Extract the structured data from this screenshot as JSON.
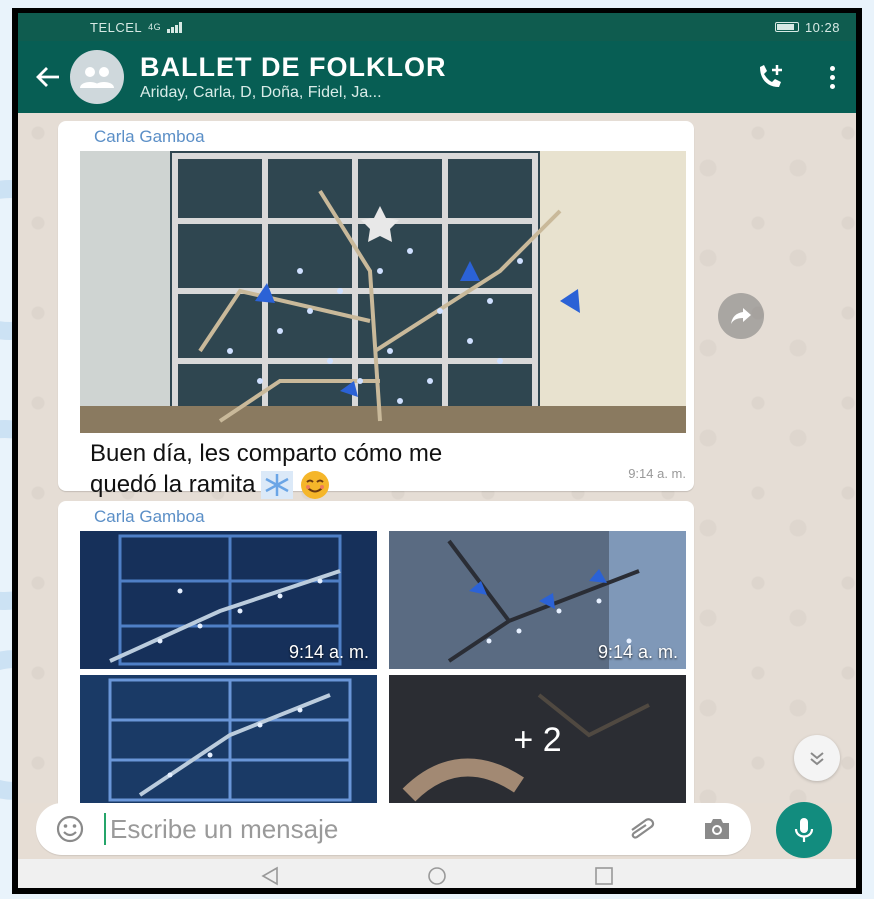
{
  "status_bar": {
    "carrier": "TELCEL",
    "network": "4G",
    "time": "10:28"
  },
  "header": {
    "title": "BALLET DE FOLKLOR",
    "members": "Ariday, Carla, D, Doña, Fidel, Ja..."
  },
  "messages": [
    {
      "sender": "Carla Gamboa",
      "text_line1": "Buen día, les comparto cómo me",
      "text_line2": "quedó la ramita",
      "time": "9:14 a. m."
    },
    {
      "sender": "Carla Gamboa",
      "photos": [
        {
          "time": "9:14 a. m."
        },
        {
          "time": "9:14 a. m."
        },
        {
          "time": ""
        },
        {
          "more": "+ 2"
        }
      ]
    }
  ],
  "input": {
    "placeholder": "Escribe un mensaje"
  },
  "colors": {
    "header": "#075e54",
    "status_bar": "#0f5c4f",
    "accent": "#128c7e",
    "sender": "#5b8fc7"
  },
  "icons": [
    "back-arrow-icon",
    "group-avatar-icon",
    "add-call-icon",
    "more-vert-icon",
    "forward-icon",
    "scroll-down-icon",
    "emoji-icon",
    "attach-icon",
    "camera-icon",
    "mic-icon",
    "nav-back-icon",
    "nav-home-icon",
    "nav-recents-icon"
  ]
}
